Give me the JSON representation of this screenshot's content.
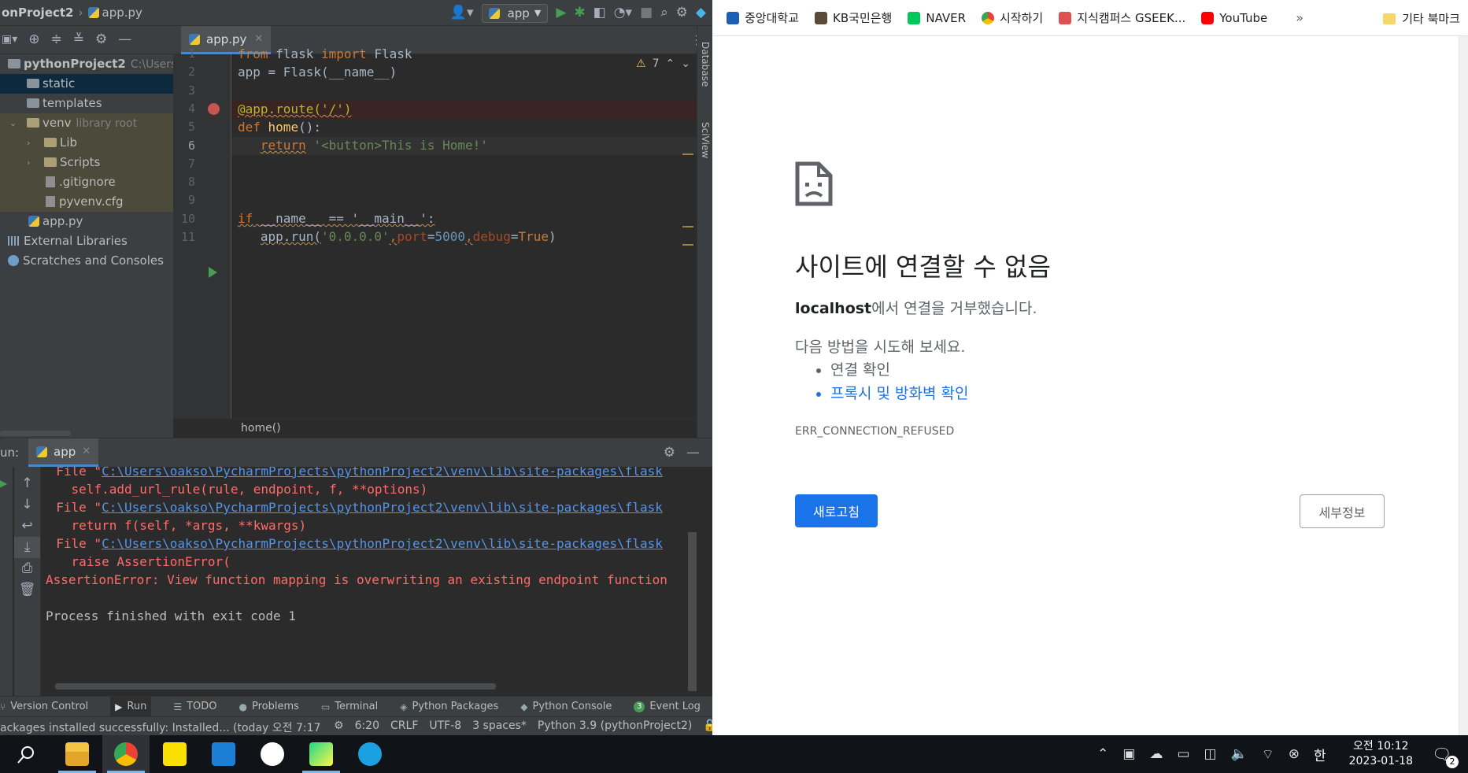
{
  "ide": {
    "project_crumb": "onProject2",
    "file_crumb": "app.py",
    "run_config": "app",
    "project_root": {
      "name": "pythonProject2",
      "path": "C:\\Users\\"
    },
    "tree": [
      {
        "label": "static",
        "kind": "folder"
      },
      {
        "label": "templates",
        "kind": "folder"
      },
      {
        "label": "venv",
        "kind": "folder",
        "extra": "library root"
      },
      {
        "label": "Lib",
        "kind": "folder"
      },
      {
        "label": "Scripts",
        "kind": "folder"
      },
      {
        "label": ".gitignore",
        "kind": "file"
      },
      {
        "label": "pyvenv.cfg",
        "kind": "file"
      },
      {
        "label": "app.py",
        "kind": "py"
      },
      {
        "label": "External Libraries",
        "kind": "lib"
      },
      {
        "label": "Scratches and Consoles",
        "kind": "scratch"
      }
    ],
    "editor_tab": "app.py",
    "warnings_count": "7",
    "line_numbers": [
      "1",
      "2",
      "3",
      "4",
      "5",
      "6",
      "7",
      "8",
      "9",
      "10",
      "11"
    ],
    "code": {
      "l1_from": "from",
      "l1_mod": " flask ",
      "l1_import": "import",
      "l1_name": " Flask",
      "l2": "app = Flask(__name__)",
      "l4": "@app.route('/')",
      "l5_def": "def",
      "l5_fn": " home",
      "l5_rest": "():",
      "l6_ret": "return",
      "l6_str": " '<button>This is Home!'",
      "l10_if": "if",
      "l10_rest": " __name__ == '__main__':",
      "l11_a": "app.run(",
      "l11_s": "'0.0.0.0'",
      "l11_c1": ",",
      "l11_p1": "port",
      "l11_eq1": "=",
      "l11_n": "5000",
      "l11_c2": ",",
      "l11_p2": "debug",
      "l11_eq2": "=",
      "l11_t": "True",
      "l11_end": ")"
    },
    "breadcrumb": "home()",
    "side_labels": {
      "database": "Database",
      "sciview": "SciView"
    },
    "run": {
      "label": "un:",
      "tab": "app",
      "lines": {
        "f1_pre": "  File \"",
        "f1_link": "C:\\Users\\oakso\\PycharmProjects\\pythonProject2\\venv\\lib\\site-packages\\flask",
        "c1": "    self.add_url_rule(rule, endpoint, f, **options)",
        "f2_pre": "  File \"",
        "f2_link": "C:\\Users\\oakso\\PycharmProjects\\pythonProject2\\venv\\lib\\site-packages\\flask",
        "c2": "    return f(self, *args, **kwargs)",
        "f3_pre": "  File \"",
        "f3_link": "C:\\Users\\oakso\\PycharmProjects\\pythonProject2\\venv\\lib\\site-packages\\flask",
        "c3": "    raise AssertionError(",
        "assert": "AssertionError: View function mapping is overwriting an existing endpoint function",
        "exit": "Process finished with exit code 1"
      }
    },
    "tool_tabs": [
      "Version Control",
      "Run",
      "TODO",
      "Problems",
      "Terminal",
      "Python Packages",
      "Python Console",
      "Event Log"
    ],
    "event_log_count": "3",
    "status": {
      "message": "ackages installed successfully: Installed... (today 오전 7:17",
      "position": "6:20",
      "line_sep": "CRLF",
      "encoding": "UTF-8",
      "indent": "3 spaces*",
      "interpreter": "Python 3.9 (pythonProject2)"
    }
  },
  "browser": {
    "bookmarks": [
      {
        "label": "중앙대학교",
        "color": "#1a5fb4"
      },
      {
        "label": "KB국민은행",
        "color": "#5a4a3a"
      },
      {
        "label": "NAVER",
        "color": "#03c75a"
      },
      {
        "label": "시작하기",
        "color": "#4285f4"
      },
      {
        "label": "지식캠퍼스 GSEEK...",
        "color": "#e05050"
      },
      {
        "label": "YouTube",
        "color": "#ff0000"
      }
    ],
    "overflow": "»",
    "other_bookmarks": "기타 북마크",
    "error": {
      "title": "사이트에 연결할 수 없음",
      "host": "localhost",
      "desc_rest": "에서 연결을 거부했습니다.",
      "try_head": "다음 방법을 시도해 보세요.",
      "suggestions": [
        "연결 확인",
        "프록시 및 방화벽 확인"
      ],
      "code": "ERR_CONNECTION_REFUSED",
      "reload": "새로고침",
      "details": "세부정보"
    }
  },
  "taskbar": {
    "clock_time": "오전 10:12",
    "clock_date": "2023-01-18",
    "ime": "한",
    "notif_count": "2"
  }
}
